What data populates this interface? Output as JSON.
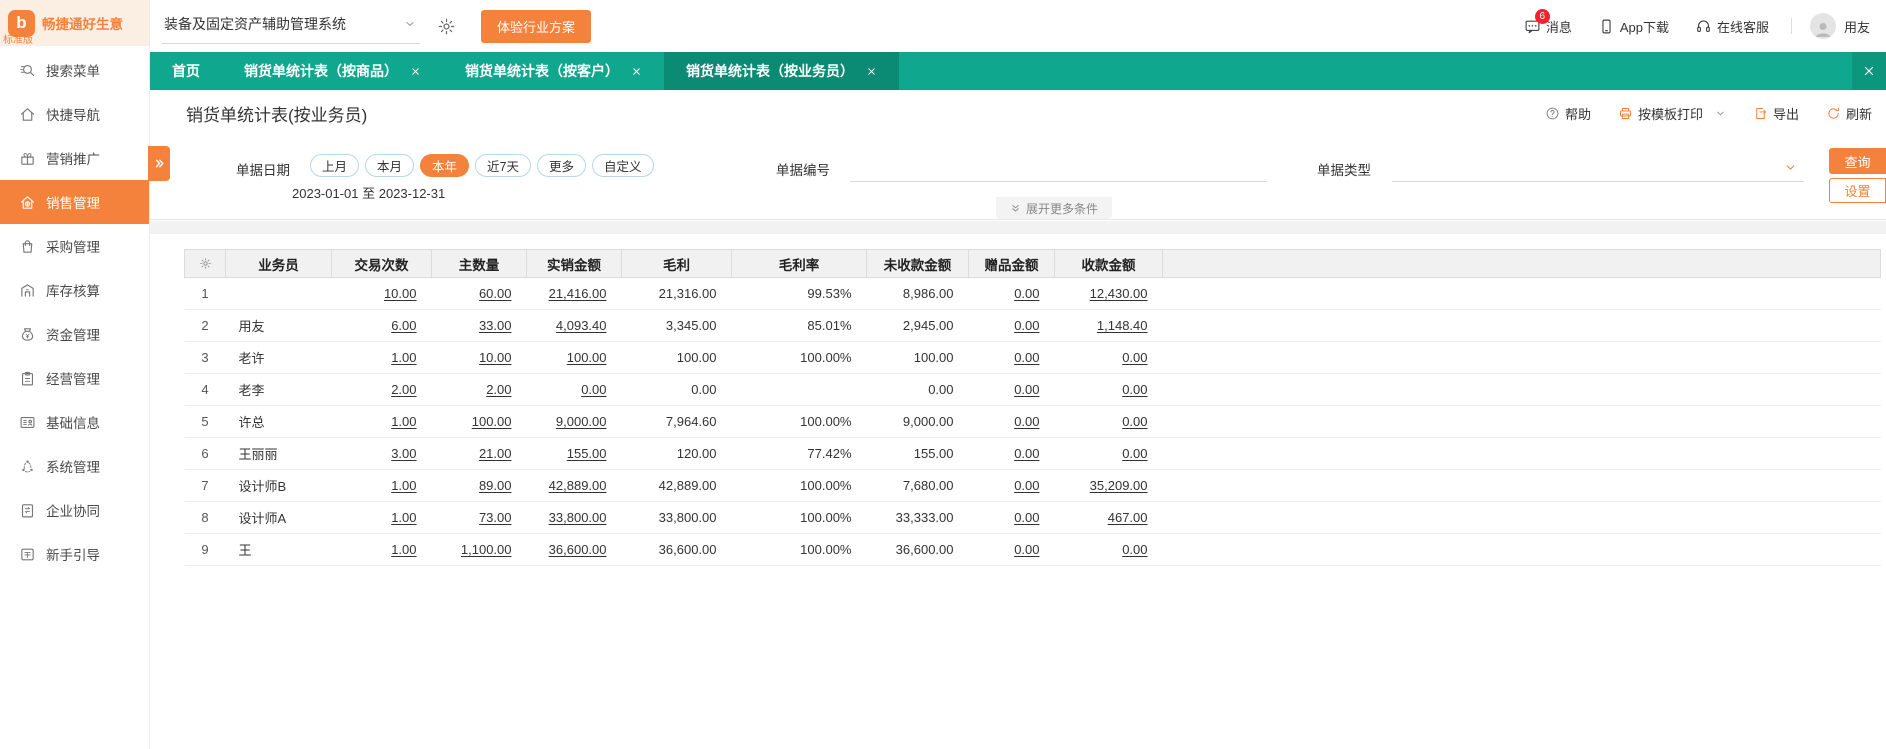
{
  "colors": {
    "accent": "#f5823c",
    "teal": "#0fa78d",
    "teal_dark": "#0b8a74",
    "badge_red": "#f5222d"
  },
  "brand": {
    "name": "畅捷通好生意",
    "edition": "标准版"
  },
  "topbar": {
    "system_select": "装备及固定资产辅助管理系统",
    "trial_button": "体验行业方案",
    "messages_label": "消息",
    "messages_badge": "6",
    "app_download_label": "App下载",
    "service_label": "在线客服",
    "username": "用友"
  },
  "sidebar": {
    "items": [
      {
        "key": "search",
        "label": "搜索菜单",
        "icon": "search-icon",
        "active": false
      },
      {
        "key": "quick-nav",
        "label": "快捷导航",
        "icon": "home-icon",
        "active": false
      },
      {
        "key": "marketing",
        "label": "营销推广",
        "icon": "gift-icon",
        "active": false
      },
      {
        "key": "sales",
        "label": "销售管理",
        "icon": "sales-icon",
        "active": true
      },
      {
        "key": "purchase",
        "label": "采购管理",
        "icon": "purchase-bag-icon",
        "active": false
      },
      {
        "key": "inventory",
        "label": "库存核算",
        "icon": "warehouse-icon",
        "active": false
      },
      {
        "key": "funds",
        "label": "资金管理",
        "icon": "money-bag-icon",
        "active": false
      },
      {
        "key": "operations",
        "label": "经营管理",
        "icon": "clipboard-icon",
        "active": false
      },
      {
        "key": "master-data",
        "label": "基础信息",
        "icon": "id-card-icon",
        "active": false
      },
      {
        "key": "system",
        "label": "系统管理",
        "icon": "system-nodes-icon",
        "active": false
      },
      {
        "key": "collaboration",
        "label": "企业协同",
        "icon": "collaboration-icon",
        "active": false
      },
      {
        "key": "guide",
        "label": "新手引导",
        "icon": "guide-icon",
        "active": false
      }
    ]
  },
  "tabs": [
    {
      "label": "首页",
      "closable": false,
      "active": false
    },
    {
      "label": "销货单统计表（按商品）",
      "closable": true,
      "active": false
    },
    {
      "label": "销货单统计表（按客户）",
      "closable": true,
      "active": false
    },
    {
      "label": "销货单统计表（按业务员）",
      "closable": true,
      "active": true
    }
  ],
  "page": {
    "title": "销货单统计表(按业务员)",
    "toolbar": {
      "help": "帮助",
      "print": "按模板打印",
      "export": "导出",
      "refresh": "刷新"
    }
  },
  "filters": {
    "date_label": "单据日期",
    "date_pills": [
      "上月",
      "本月",
      "本年",
      "近7天",
      "更多",
      "自定义"
    ],
    "active_pill": "本年",
    "date_range": "2023-01-01 至 2023-12-31",
    "doc_no_label": "单据编号",
    "doc_type_label": "单据类型",
    "search_button": "查询",
    "settings_button": "设置",
    "expand_more": "展开更多条件"
  },
  "table": {
    "columns": [
      "业务员",
      "交易次数",
      "主数量",
      "实销金额",
      "毛利",
      "毛利率",
      "未收款金额",
      "赠品金额",
      "收款金额"
    ],
    "link_value_indexes": [
      0,
      1,
      2,
      6,
      7
    ],
    "rows": [
      {
        "num": "1",
        "name": "",
        "values": [
          "10.00",
          "60.00",
          "21,416.00",
          "21,316.00",
          "99.53%",
          "8,986.00",
          "0.00",
          "12,430.00"
        ]
      },
      {
        "num": "2",
        "name": "用友",
        "values": [
          "6.00",
          "33.00",
          "4,093.40",
          "3,345.00",
          "85.01%",
          "2,945.00",
          "0.00",
          "1,148.40"
        ]
      },
      {
        "num": "3",
        "name": "老许",
        "values": [
          "1.00",
          "10.00",
          "100.00",
          "100.00",
          "100.00%",
          "100.00",
          "0.00",
          "0.00"
        ]
      },
      {
        "num": "4",
        "name": "老李",
        "values": [
          "2.00",
          "2.00",
          "0.00",
          "0.00",
          "",
          "0.00",
          "0.00",
          "0.00"
        ]
      },
      {
        "num": "5",
        "name": "许总",
        "values": [
          "1.00",
          "100.00",
          "9,000.00",
          "7,964.60",
          "100.00%",
          "9,000.00",
          "0.00",
          "0.00"
        ]
      },
      {
        "num": "6",
        "name": "王丽丽",
        "values": [
          "3.00",
          "21.00",
          "155.00",
          "120.00",
          "77.42%",
          "155.00",
          "0.00",
          "0.00"
        ]
      },
      {
        "num": "7",
        "name": "设计师B",
        "values": [
          "1.00",
          "89.00",
          "42,889.00",
          "42,889.00",
          "100.00%",
          "7,680.00",
          "0.00",
          "35,209.00"
        ]
      },
      {
        "num": "8",
        "name": "设计师A",
        "values": [
          "1.00",
          "73.00",
          "33,800.00",
          "33,800.00",
          "100.00%",
          "33,333.00",
          "0.00",
          "467.00"
        ]
      },
      {
        "num": "9",
        "name": "王",
        "values": [
          "1.00",
          "1,100.00",
          "36,600.00",
          "36,600.00",
          "100.00%",
          "36,600.00",
          "0.00",
          "0.00"
        ]
      }
    ]
  }
}
